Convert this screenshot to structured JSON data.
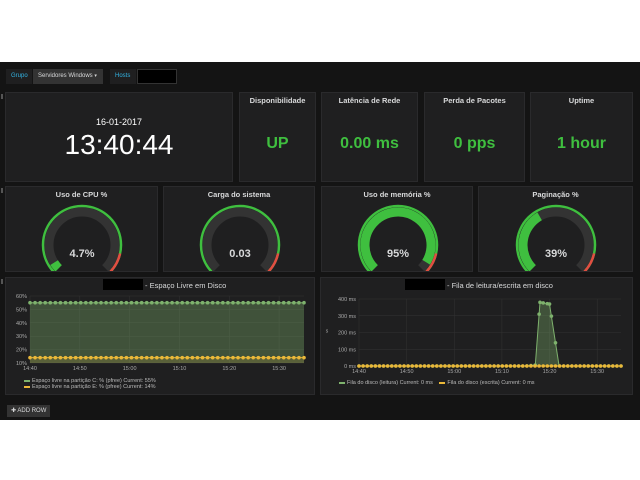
{
  "toolbar": {
    "group_label": "Grupo",
    "group_value": "Servidores Windows",
    "hosts_label": "Hosts",
    "hosts_value": ""
  },
  "clock": {
    "date": "16-01-2017",
    "time": "13:40:44"
  },
  "singlestats": [
    {
      "title": "Disponibilidade",
      "value": "UP"
    },
    {
      "title": "Latência de Rede",
      "value": "0.00 ms"
    },
    {
      "title": "Perda de Pacotes",
      "value": "0 pps"
    },
    {
      "title": "Uptime",
      "value": "1 hour"
    }
  ],
  "gauges": [
    {
      "title": "Uso de CPU %",
      "value": "4.7%",
      "level": 0.047
    },
    {
      "title": "Carga do sistema",
      "value": "0.03",
      "level": 0.0
    },
    {
      "title": "Uso de memória %",
      "value": "95%",
      "level": 0.95
    },
    {
      "title": "Paginação %",
      "value": "39%",
      "level": 0.39
    }
  ],
  "colors": {
    "ok": "#3fbf3f",
    "warn": "#e24d42",
    "green_series": "#7eb26d",
    "yellow_series": "#eab839",
    "gauge_track": "#333333"
  },
  "disk_panel": {
    "title": "- Espaço Livre em Disco",
    "legend": [
      "Espaço livre na partição C: % (pfree)  Current: 55%",
      "Espaço livre na partição E: % (pfree)  Current: 14%"
    ]
  },
  "io_panel": {
    "title": "- Fila de leitura/escrita em disco",
    "legend": [
      "Fila do disco (leitura)  Current: 0 ms",
      "Fila do disco (escrita)  Current: 0 ms"
    ]
  },
  "chart_data": [
    {
      "type": "area",
      "title": "- Espaço Livre em Disco",
      "x_ticks": [
        "14:40",
        "14:50",
        "15:00",
        "15:10",
        "15:20",
        "15:30"
      ],
      "y_ticks": [
        "10%",
        "20%",
        "30%",
        "40%",
        "50%",
        "60%"
      ],
      "ylim": [
        10,
        60
      ],
      "x": [
        "14:40",
        "14:50",
        "15:00",
        "15:10",
        "15:20",
        "15:30",
        "15:35"
      ],
      "series": [
        {
          "name": "Espaço livre na partição C: % (pfree)",
          "values": [
            55,
            55,
            55,
            55,
            55,
            55,
            55
          ]
        },
        {
          "name": "Espaço livre na partição E: % (pfree)",
          "values": [
            14,
            14,
            14,
            14,
            14,
            14,
            14
          ]
        }
      ],
      "grid": true,
      "legend": "bottom-left"
    },
    {
      "type": "line",
      "title": "- Fila de leitura/escrita em disco",
      "x_ticks": [
        "14:40",
        "14:50",
        "15:00",
        "15:10",
        "15:20",
        "15:30"
      ],
      "y_ticks": [
        "0 ms",
        "100 ms",
        "200 ms",
        "300 ms",
        "400 ms"
      ],
      "ylabel": "s",
      "ylim": [
        0,
        400
      ],
      "x": [
        "14:40",
        "14:50",
        "15:00",
        "15:10",
        "15:15",
        "15:17",
        "15:18",
        "15:20",
        "15:22",
        "15:30",
        "15:35"
      ],
      "series": [
        {
          "name": "Fila do disco (leitura)",
          "values": [
            0,
            0,
            0,
            0,
            0,
            5,
            380,
            370,
            0,
            0,
            0
          ]
        },
        {
          "name": "Fila do disco (escrita)",
          "values": [
            0,
            0,
            0,
            0,
            0,
            0,
            0,
            0,
            0,
            0,
            0
          ]
        }
      ],
      "grid": true,
      "legend": "bottom-left"
    }
  ],
  "add_row_label": "ADD ROW"
}
